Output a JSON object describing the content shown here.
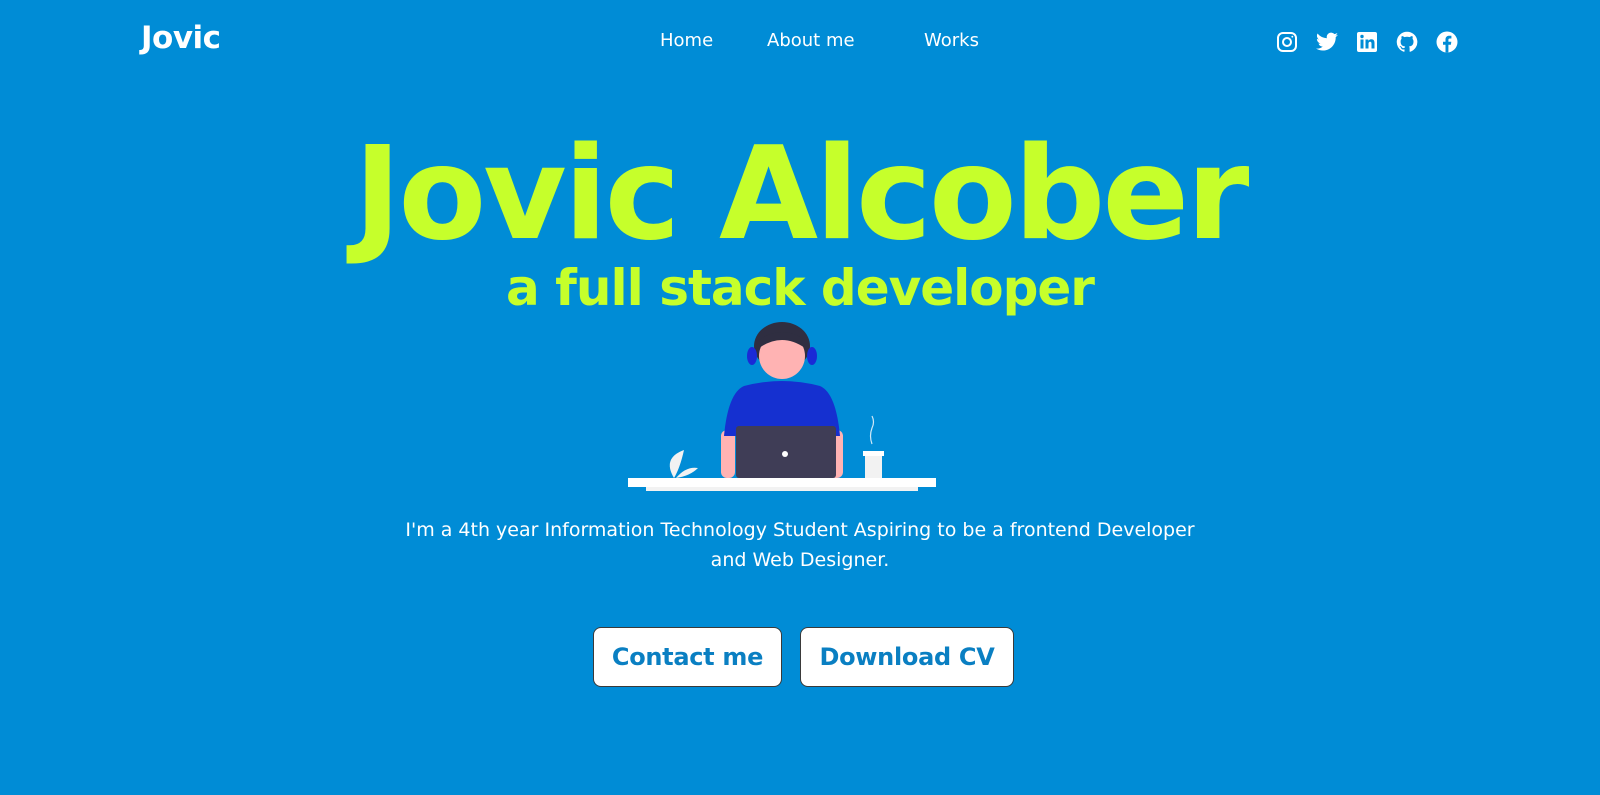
{
  "nav": {
    "logo": "Jovic",
    "links": [
      "Home",
      "About me",
      "Works"
    ],
    "social_icons": [
      "instagram-icon",
      "twitter-icon",
      "linkedin-icon",
      "github-icon",
      "facebook-icon"
    ]
  },
  "hero": {
    "title": "Jovic Alcober",
    "subtitle": "a full stack developer",
    "intro": "I'm a 4th year Information Technology Student Aspiring to be a frontend Developer and Web Designer.",
    "buttons": {
      "contact": "Contact me",
      "download": "Download CV"
    }
  },
  "colors": {
    "background": "#008cd6",
    "accent": "#c6ff2b",
    "button_text": "#0a7fc2",
    "text": "#ffffff"
  }
}
